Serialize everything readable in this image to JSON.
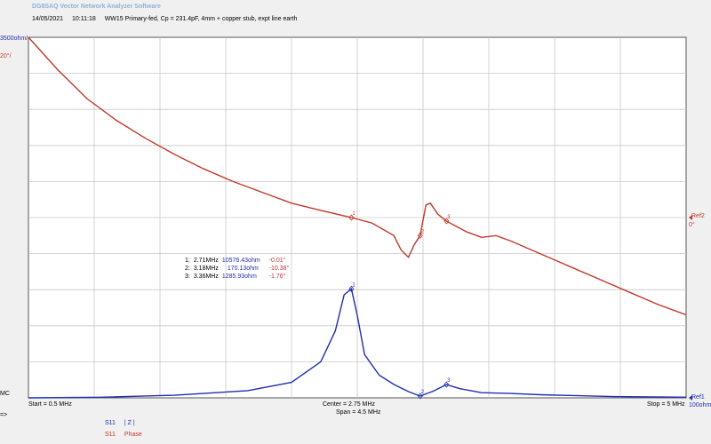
{
  "app": {
    "title": "DG8SAQ Vector Network Analyzer Software",
    "date": "14/05/2021",
    "time": "10:11:18",
    "description": "WW15 Primary-fed, Cp = 231.4pF, 4mm + copper stub, expt line earth"
  },
  "left_labels": {
    "top_mag": "3500ohm/",
    "top_phase": "20°/",
    "mc": "MC",
    "arrow": "=>"
  },
  "right_labels": {
    "ref2": "Ref2",
    "ref2_value": "0°",
    "ref1": "Ref1",
    "ref1_value": "100ohm"
  },
  "axis": {
    "start": "Start = 0.5 MHz",
    "center": "Center = 2.75 MHz",
    "span": "Span = 4.5 MHz",
    "stop": "Stop = 5 MHz"
  },
  "markers": [
    {
      "id": "1:",
      "freq": "2.71MHz",
      "mag": "10576.43ohm",
      "phase": "-0.01°"
    },
    {
      "id": "2:",
      "freq": "3.18MHz",
      "mag": "170.13ohm",
      "phase": "-10.38°"
    },
    {
      "id": "3:",
      "freq": "3.36MHz",
      "mag": "1285.93ohm",
      "phase": "-1.76°"
    }
  ],
  "legend": [
    {
      "param": "S11",
      "label": "| Z |",
      "color": "#1f2fb0"
    },
    {
      "param": "S11",
      "label": "Phase",
      "color": "#c0392b"
    }
  ],
  "chart_data": {
    "type": "line",
    "x_unit": "MHz",
    "xlim": [
      0.5,
      5.0
    ],
    "grid": true,
    "series": [
      {
        "name": "| Z |",
        "color": "#1f2fb0",
        "y_unit": "ohm",
        "ylim": [
          0,
          35000
        ],
        "points": [
          [
            0.5,
            0
          ],
          [
            1.0,
            60
          ],
          [
            1.5,
            250
          ],
          [
            2.0,
            700
          ],
          [
            2.3,
            1500
          ],
          [
            2.5,
            3500
          ],
          [
            2.6,
            6500
          ],
          [
            2.66,
            10000
          ],
          [
            2.71,
            10576
          ],
          [
            2.75,
            8000
          ],
          [
            2.8,
            4200
          ],
          [
            2.9,
            2200
          ],
          [
            3.0,
            1300
          ],
          [
            3.1,
            600
          ],
          [
            3.18,
            170
          ],
          [
            3.27,
            650
          ],
          [
            3.36,
            1286
          ],
          [
            3.45,
            900
          ],
          [
            3.6,
            500
          ],
          [
            3.8,
            420
          ],
          [
            4.0,
            300
          ],
          [
            4.5,
            120
          ],
          [
            5.0,
            60
          ]
        ]
      },
      {
        "name": "Phase",
        "color": "#c0392b",
        "y_unit": "deg",
        "ylim": [
          -100,
          100
        ],
        "points": [
          [
            0.5,
            100
          ],
          [
            0.7,
            82
          ],
          [
            0.9,
            66
          ],
          [
            1.1,
            54
          ],
          [
            1.3,
            44
          ],
          [
            1.5,
            35
          ],
          [
            1.7,
            27
          ],
          [
            1.9,
            20
          ],
          [
            2.1,
            14
          ],
          [
            2.3,
            8
          ],
          [
            2.5,
            4
          ],
          [
            2.71,
            0
          ],
          [
            2.85,
            -3
          ],
          [
            3.0,
            -10
          ],
          [
            3.05,
            -18
          ],
          [
            3.1,
            -22
          ],
          [
            3.14,
            -15
          ],
          [
            3.18,
            -10
          ],
          [
            3.22,
            7
          ],
          [
            3.25,
            8
          ],
          [
            3.3,
            2
          ],
          [
            3.36,
            -2
          ],
          [
            3.5,
            -8
          ],
          [
            3.6,
            -11
          ],
          [
            3.7,
            -10
          ],
          [
            3.8,
            -13
          ],
          [
            4.0,
            -20
          ],
          [
            4.2,
            -27
          ],
          [
            4.4,
            -34
          ],
          [
            4.6,
            -41
          ],
          [
            4.8,
            -48
          ],
          [
            5.0,
            -54
          ]
        ]
      }
    ],
    "markers": [
      {
        "label": "1",
        "x": 2.71
      },
      {
        "label": "2",
        "x": 3.18
      },
      {
        "label": "3",
        "x": 3.36
      }
    ]
  }
}
